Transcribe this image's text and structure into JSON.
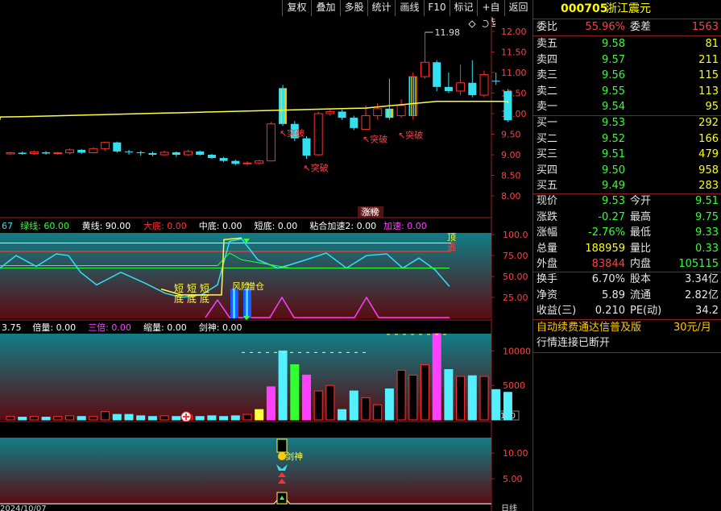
{
  "toolbar": {
    "buttons": [
      "复权",
      "叠加",
      "多股",
      "统计",
      "画线",
      "F10",
      "标记",
      "+自选",
      "返回"
    ]
  },
  "price_chart": {
    "y_ticks": [
      "12.00",
      "11.50",
      "11.00",
      "10.50",
      "10.00",
      "9.50",
      "9.00",
      "8.50",
      "8.00"
    ],
    "high_label": "11.98",
    "breakout_labels": [
      "突破",
      "突破",
      "突破",
      "突破"
    ],
    "bottom_label": "涨榜",
    "colors": {
      "up": "#ff3030",
      "down": "#33e0f0",
      "ma": "#ffff40"
    }
  },
  "indicator1": {
    "header": [
      {
        "text": "67",
        "color": "#33e0f0"
      },
      {
        "text": "绿线: 60.00",
        "color": "#33ff33"
      },
      {
        "text": "黄线: 90.00",
        "color": "#ffffff"
      },
      {
        "text": "大底: 0.00",
        "color": "#ff3030"
      },
      {
        "text": "中底: 0.00",
        "color": "#ffffff"
      },
      {
        "text": "短底: 0.00",
        "color": "#ffffff"
      },
      {
        "text": "粘合加速2: 0.00",
        "color": "#ffffff"
      },
      {
        "text": "加速: 0.00",
        "color": "#ff40ff"
      }
    ],
    "y_ticks": [
      "100.0",
      "75.00",
      "50.00",
      "25.00"
    ],
    "labels": {
      "top": "顶",
      "escape": "逃",
      "short_bottom": [
        "短底",
        "短底",
        "短底"
      ],
      "risk": "风险",
      "add": "增仓"
    }
  },
  "volume": {
    "header": [
      {
        "text": "3.75",
        "color": "#ffffff"
      },
      {
        "text": "倍量: 0.00",
        "color": "#ffffff"
      },
      {
        "text": "三倍: 0.00",
        "color": "#ff40ff"
      },
      {
        "text": "缩量: 0.00",
        "color": "#ffffff"
      },
      {
        "text": "剑神: 0.00",
        "color": "#ffffff"
      }
    ],
    "y_ticks": [
      "10000",
      "5000"
    ],
    "unit": "X100"
  },
  "indicator3": {
    "y_ticks": [
      "10.00",
      "5.00"
    ],
    "label": "剑神",
    "date_text": "2024/10/07",
    "axis_tag": "日线"
  },
  "quote": {
    "code": "000705",
    "name": "浙江震元",
    "weibi_label": "委比",
    "weibi_value": "55.96%",
    "weicha_label": "委差",
    "weicha_value": "1563",
    "asks": [
      {
        "label": "卖五",
        "price": "9.58",
        "vol": "81"
      },
      {
        "label": "卖四",
        "price": "9.57",
        "vol": "211"
      },
      {
        "label": "卖三",
        "price": "9.56",
        "vol": "115"
      },
      {
        "label": "卖二",
        "price": "9.55",
        "vol": "113"
      },
      {
        "label": "卖一",
        "price": "9.54",
        "vol": "95"
      }
    ],
    "bids": [
      {
        "label": "买一",
        "price": "9.53",
        "vol": "292"
      },
      {
        "label": "买二",
        "price": "9.52",
        "vol": "166"
      },
      {
        "label": "买三",
        "price": "9.51",
        "vol": "479"
      },
      {
        "label": "买四",
        "price": "9.50",
        "vol": "958"
      },
      {
        "label": "买五",
        "price": "9.49",
        "vol": "283"
      }
    ],
    "stats": [
      {
        "l1": "现价",
        "v1": "9.53",
        "c1": "green",
        "l2": "今开",
        "v2": "9.51",
        "c2": "green"
      },
      {
        "l1": "涨跌",
        "v1": "-0.27",
        "c1": "green",
        "l2": "最高",
        "v2": "9.75",
        "c2": "green"
      },
      {
        "l1": "涨幅",
        "v1": "-2.76%",
        "c1": "green",
        "l2": "最低",
        "v2": "9.33",
        "c2": "green"
      },
      {
        "l1": "总量",
        "v1": "188959",
        "c1": "yellow",
        "l2": "量比",
        "v2": "0.33",
        "c2": "green"
      },
      {
        "l1": "外盘",
        "v1": "83844",
        "c1": "red",
        "l2": "内盘",
        "v2": "105115",
        "c2": "green"
      }
    ],
    "stats2": [
      {
        "l1": "换手",
        "v1": "6.70%",
        "l2": "股本",
        "v2": "3.34亿"
      },
      {
        "l1": "净资",
        "v1": "5.89",
        "l2": "流通",
        "v2": "2.82亿"
      },
      {
        "l1": "收益(三)",
        "v1": "0.210",
        "l2": "PE(动)",
        "v2": "34.2"
      }
    ],
    "promo": "自动续费通达信普及版",
    "promo_price": "30元/月",
    "status": "行情连接已断开"
  }
}
